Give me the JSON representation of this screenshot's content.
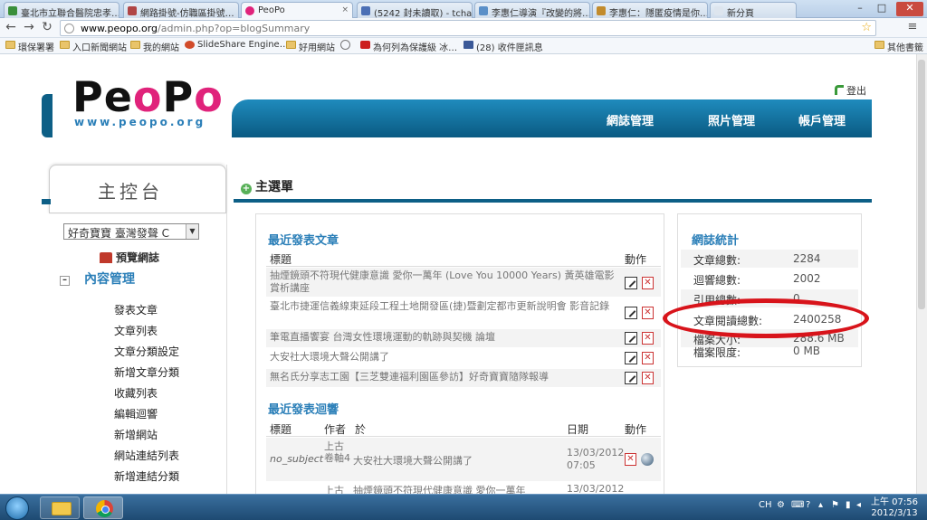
{
  "browser": {
    "tabs": [
      {
        "label": "臺北市立聯合醫院忠孝…",
        "color": "#3a8f3a"
      },
      {
        "label": "網路掛號-仿職區掛號…",
        "color": "#b04545"
      },
      {
        "label": "PeoPo",
        "color": "#e0237b",
        "active": true
      },
      {
        "label": "(5242 封未讀取) - tcha…",
        "color": "#4b6fb5"
      },
      {
        "label": "李惠仁導演『改變的將…",
        "color": "#5a8fc8"
      },
      {
        "label": "李惠仁：隱匿疫情是你…",
        "color": "#c28b2c"
      },
      {
        "label": "新分頁",
        "color": "#dde5ee"
      }
    ],
    "tab_close": "×",
    "url_host": "www.peopo.org",
    "url_path": "/admin.php?op=blogSummary",
    "bookmarks": [
      {
        "label": "環保署署",
        "icon": "folder"
      },
      {
        "label": "入口新聞網站",
        "icon": "folder"
      },
      {
        "label": "我的網站",
        "icon": "folder"
      },
      {
        "label": "SlideShare Engine…",
        "icon": "slideshare"
      },
      {
        "label": "好用網站",
        "icon": "folder"
      },
      {
        "label": "",
        "icon": "globe"
      },
      {
        "label": "為何列為保護級 冰…",
        "icon": "youtube"
      },
      {
        "label": "(28) 收件匣訊息",
        "icon": "facebook"
      }
    ],
    "other_bookmarks": "其他書籤"
  },
  "site": {
    "logo": {
      "p1": "P",
      "e": "e",
      "o1": "o",
      "p2": "P",
      "o2": "o"
    },
    "logo_url": "www.peopo.org",
    "logout": "登出",
    "top_nav": [
      "網誌管理",
      "照片管理",
      "帳戶管理"
    ]
  },
  "sidebar": {
    "console_title": "主控台",
    "blog_select_value": "好奇寶寶 臺灣發聲 C",
    "preview": "預覽網誌",
    "content_mgmt": "內容管理",
    "links": [
      "發表文章",
      "文章列表",
      "文章分類設定",
      "新增文章分類",
      "收藏列表",
      "編輯迴響",
      "新增網站",
      "網站連結列表",
      "新增連結分類"
    ]
  },
  "main": {
    "menu_title": "主選單",
    "recent_posts": {
      "title": "最近發表文章",
      "col_title": "標題",
      "col_action": "動作",
      "rows": [
        "抽煙鏡頭不符現代健康意識 愛你一萬年 (Love You 10000 Years) 黃英雄電影賞析講座",
        "臺北市捷運信義線東延段工程土地開發區(捷)暨劃定都市更新說明會 影音記錄",
        "筆電直播饗宴 台灣女性環境運動的軌跡與契機 論壇",
        "大安社大環境大聲公開講了",
        "無名氏分享志工園【三芝雙連福利園區參訪】好奇寶寶隨隊報導"
      ]
    },
    "recent_comments": {
      "title": "最近發表迴響",
      "col_title": "標題",
      "col_author": "作者",
      "col_on": "於",
      "col_date": "日期",
      "col_action": "動作",
      "rows": [
        {
          "subject": "no_subject",
          "author": "上古卷軸4",
          "on": "大安社大環境大聲公開講了",
          "date": "13/03/2012 07:05"
        },
        {
          "subject": "",
          "author": "上古",
          "on": "抽煙鏡頭不符現代健康意識 愛你一萬年",
          "date": "13/03/2012"
        }
      ]
    },
    "stats": {
      "title": "網誌統計",
      "rows": [
        {
          "label": "文章總數:",
          "value": "2284"
        },
        {
          "label": "迴響總數:",
          "value": "2002"
        },
        {
          "label": "引用總數:",
          "value": "0"
        },
        {
          "label": "文章閱讀總數:",
          "value": "2400258"
        },
        {
          "label": "檔案大小:",
          "value": "288.6 MB"
        },
        {
          "label": "檔案限度:",
          "value": "0 MB"
        }
      ],
      "highlight_color": "#d8141b"
    }
  },
  "taskbar": {
    "lang": "CH",
    "time": "上午 07:56",
    "date": "2012/3/13"
  }
}
